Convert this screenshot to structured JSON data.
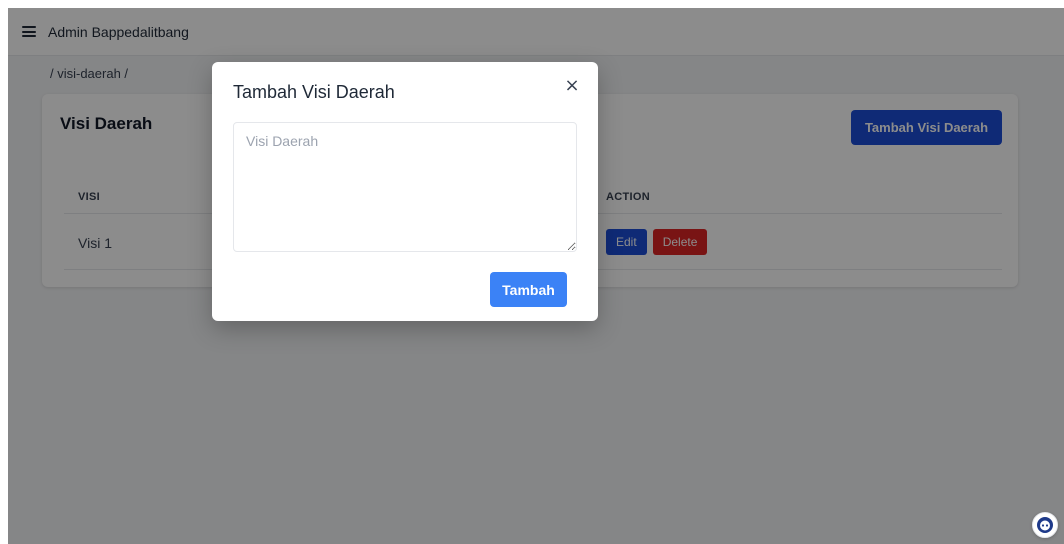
{
  "app": {
    "title": "Admin Bappedalitbang"
  },
  "breadcrumb": "/ visi-daerah /",
  "card": {
    "title": "Visi Daerah",
    "add_button": "Tambah Visi Daerah"
  },
  "table": {
    "headers": [
      "VISI",
      "ACTION"
    ],
    "rows": [
      {
        "visi": "Visi 1",
        "edit": "Edit",
        "delete": "Delete"
      }
    ]
  },
  "modal": {
    "title": "Tambah Visi Daerah",
    "close": "×",
    "textarea_placeholder": "Visi Daerah",
    "textarea_value": "",
    "submit_button": "Tambah"
  },
  "colors": {
    "primary": "#1d4ed8",
    "danger": "#dc2626",
    "submit": "#3b82f6"
  }
}
